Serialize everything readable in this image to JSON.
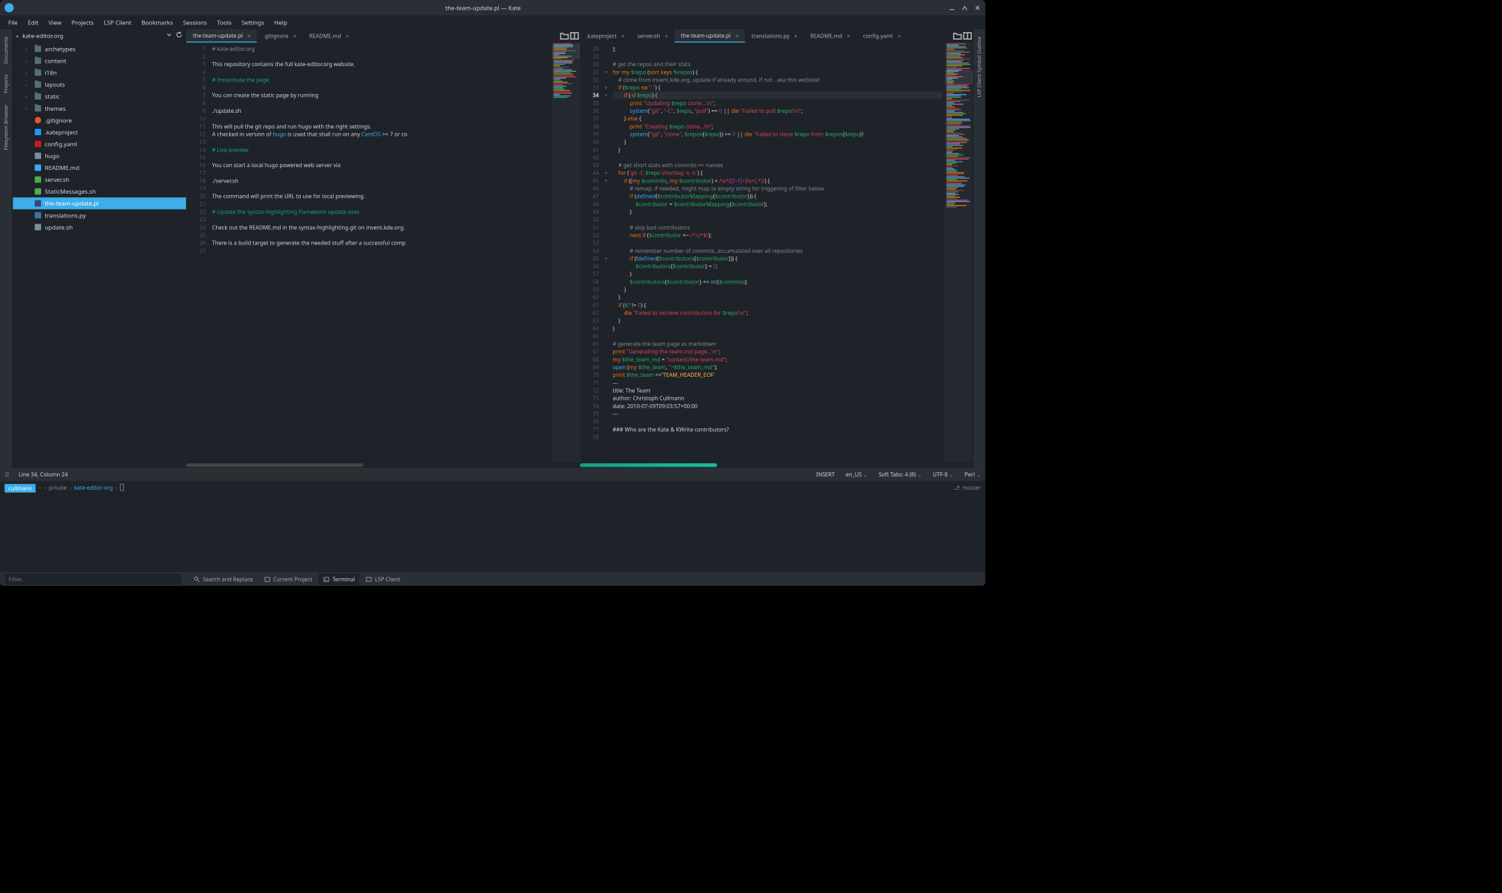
{
  "window": {
    "title": "the-team-update.pl — Kate"
  },
  "menu": [
    "File",
    "Edit",
    "View",
    "Projects",
    "LSP Client",
    "Bookmarks",
    "Sessions",
    "Tools",
    "Settings",
    "Help"
  ],
  "leftrail": [
    "Documents",
    "Projects",
    "Filesystem Browser"
  ],
  "rightrail": [
    "LSP Client Symbol Outline"
  ],
  "project": {
    "name": "kate-editor.org"
  },
  "tree": [
    {
      "label": "archetypes",
      "type": "folder",
      "expand": true
    },
    {
      "label": "content",
      "type": "folder",
      "expand": true
    },
    {
      "label": "i18n",
      "type": "folder",
      "expand": true
    },
    {
      "label": "layouts",
      "type": "folder",
      "expand": true
    },
    {
      "label": "static",
      "type": "folder",
      "expand": true
    },
    {
      "label": "themes",
      "type": "folder",
      "expand": true
    },
    {
      "label": ".gitignore",
      "type": "git"
    },
    {
      "label": ".kateproject",
      "type": "blue"
    },
    {
      "label": "config.yaml",
      "type": "yml"
    },
    {
      "label": "hugo",
      "type": "file"
    },
    {
      "label": "README.md",
      "type": "md"
    },
    {
      "label": "server.sh",
      "type": "sh"
    },
    {
      "label": "StaticMessages.sh",
      "type": "sh"
    },
    {
      "label": "the-team-update.pl",
      "type": "pl",
      "sel": true
    },
    {
      "label": "translations.py",
      "type": "py"
    },
    {
      "label": "update.sh",
      "type": "file"
    }
  ],
  "leftTabs": [
    {
      "label": "the-team-update.pl",
      "act": true
    },
    {
      "label": ".gitignore"
    },
    {
      "label": "README.md"
    }
  ],
  "rightTabs": [
    {
      "label": ".kateproject"
    },
    {
      "label": "server.sh"
    },
    {
      "label": "the-team-update.pl",
      "act": true
    },
    {
      "label": "translations.py"
    },
    {
      "label": "README.md"
    },
    {
      "label": "config.yaml"
    }
  ],
  "leftLines": [
    1,
    2,
    3,
    4,
    5,
    6,
    7,
    8,
    9,
    10,
    11,
    12,
    13,
    14,
    15,
    16,
    17,
    18,
    19,
    20,
    21,
    22,
    23,
    24,
    25,
    26,
    27
  ],
  "rightLines": [
    28,
    29,
    30,
    31,
    32,
    33,
    34,
    35,
    36,
    37,
    38,
    39,
    40,
    41,
    42,
    43,
    44,
    45,
    46,
    47,
    48,
    49,
    50,
    51,
    52,
    53,
    54,
    55,
    56,
    57,
    58,
    59,
    60,
    61,
    62,
    63,
    64,
    65,
    66,
    67,
    68,
    69,
    70,
    71,
    72,
    73,
    74,
    75,
    76,
    77,
    78
  ],
  "leftCode": [
    "<span class='c-c'># kate-editor.org</span>",
    "",
    "This repository contains the full kate-editor.org website.",
    "",
    "<span class='c-h'># Instantiate the page</span>",
    "",
    "You can create the static page by running",
    "",
    "./update.sh",
    "",
    "This will pull the git repo and run hugo with the right settings.",
    "A checked in version of <span class='c-f'>hugo</span> is used that shall run on any <span class='c-f'>CentOS</span> >= 7 or co",
    "",
    "<span class='c-h'># Live preview</span>",
    "",
    "You can start a local hugo powered web server via",
    "",
    "./server.sh",
    "",
    "The command will print the URL to use for local previewing.",
    "",
    "<span class='c-h'># Update the syntax-highlighting framework update sites</span>",
    "",
    "Check out the README.md in the syntax-highlighting.git on invent.kde.org.",
    "",
    "There is a build target to generate the needed stuff after a successful comp",
    ""
  ],
  "rightCode": [
    ");",
    "",
    "<span class='c-c'># get the repos and their stats</span>",
    "<span class='c-k'>for</span> <span class='c-k'>my</span> <span class='c-v'>$repo</span> (<span class='c-k'>sort</span> <span class='c-k'>keys</span> <span class='c-v'>%repos</span>) {",
    "    <span class='c-c'># clone from invent.kde.org, update if already around, if not . aka this website!</span>",
    "    <span class='c-k'>if</span> (<span class='c-v'>$repo</span> <span class='c-k'>ne</span> <span class='c-s'>\".\"</span>) {",
    "        <span class='c-k'>if</span> (<span class='c-k'>-d</span> <span class='c-v'>$repo</span>) <span class='c-b'>{</span>",
    "            <span class='c-k'>print</span> <span class='c-s'>\"Updating </span><span class='c-v'>$repo</span><span class='c-s'> clone...\\n\"</span>;",
    "            <span class='c-f'>system</span>(<span class='c-s'>\"git\"</span>, <span class='c-s'>\"-C\"</span>, <span class='c-v'>$repo</span>, <span class='c-s'>\"pull\"</span>) == <span class='c-n'>0</span> || <span class='c-k'>die</span> <span class='c-s'>\"Failed to pull </span><span class='c-v'>$repo</span><span class='c-s'>!\\n\"</span>;",
    "        <span class='c-b'>}</span> <span class='c-k'>else</span> {",
    "            <span class='c-k'>print</span> <span class='c-s'>\"Creating </span><span class='c-v'>$repo</span><span class='c-s'> clone...\\n\"</span>;",
    "            <span class='c-f'>system</span>(<span class='c-s'>\"git\"</span>, <span class='c-s'>\"clone\"</span>, <span class='c-v'>$repos</span>{<span class='c-v'>$repo</span>}) == <span class='c-n'>0</span> || <span class='c-k'>die</span> <span class='c-s'>\"Failed to clone </span><span class='c-v'>$repo</span><span class='c-s'> from </span><span class='c-v'>$repos</span>{<span class='c-v'>$repo</span>}!",
    "        }",
    "    }",
    "",
    "    <span class='c-c'># get short stats with commits =&gt; names</span>",
    "    <span class='c-k'>for</span> (<span class='c-s'>`git -C </span><span class='c-v'>$repo</span><span class='c-s'> shortlog -s -n`</span>) {",
    "        <span class='c-k'>if</span> ((<span class='c-k'>my</span> <span class='c-v'>$commits</span>, <span class='c-k'>my</span> <span class='c-v'>$contributor</span>) = <span class='c-s'>/\\s*(</span><span class='c-n'>[0-9]+</span><span class='c-s'>)\\s+(.*)/</span>) {",
    "            <span class='c-c'># remap, if needed, might map to empty string for triggering of filter below</span>",
    "            <span class='c-k'>if</span> (<span class='c-f'>defined</span>(<span class='c-v'>$contributorMapping</span>{<span class='c-v'>$contributor</span>})) {",
    "                <span class='c-v'>$contributor</span> = <span class='c-v'>$contributorMapping</span>{<span class='c-v'>$contributor</span>};",
    "            }",
    "",
    "            <span class='c-c'># skip bad contributors</span>",
    "            <span class='c-k'>next</span> <span class='c-k'>if</span> (<span class='c-v'>$contributor</span> =~ <span class='c-s'>/^\\s*$/</span>);",
    "",
    "            <span class='c-c'># remember number of commits, accumulated over all repositories</span>",
    "            <span class='c-k'>if</span> (!<span class='c-f'>defined</span>(<span class='c-v'>$contributors</span>{<span class='c-v'>$contributor</span>})) {",
    "                <span class='c-v'>$contributors</span>{<span class='c-v'>$contributor</span>} = <span class='c-n'>0</span>;",
    "            }",
    "            <span class='c-v'>$contributors</span>{<span class='c-v'>$contributor</span>} += <span class='c-f'>int</span>(<span class='c-v'>$commits</span>);",
    "        }",
    "    }",
    "    <span class='c-k'>if</span> (<span class='c-v'>$?</span> != <span class='c-n'>0</span>) {",
    "        <span class='c-k'>die</span> <span class='c-s'>\"Failed to retrieve contributors for </span><span class='c-v'>$repo</span><span class='c-s'>!\\n\"</span>;",
    "    }",
    "}",
    "",
    "<span class='c-c'># generate the team page as markdown</span>",
    "<span class='c-k'>print</span> <span class='c-s'>\"Generating the-team.md page...\\n\"</span>;",
    "<span class='c-k'>my</span> <span class='c-v'>$the_team_md</span> = <span class='c-s'>\"content/the-team.md\"</span>;",
    "<span class='c-f'>open</span> (<span class='c-k'>my</span> <span class='c-v'>$the_team</span>, <span class='c-s'>\"&gt;</span><span class='c-v'>$the_team_md</span><span class='c-s'>\"</span>);",
    "<span class='c-k'>print</span> <span class='c-v'>$the_team</span> &lt;&lt;<span class='c-b'>'TEAM_HEADER_EOF'</span>",
    "---",
    "title: The Team",
    "author: Christoph Cullmann",
    "date: 2010-07-09T09:03:57+00:00",
    "---",
    "",
    "### Who are the Kate &amp; KWrite contributors?",
    "",
    ""
  ],
  "status": {
    "pos": "Line 34, Column 24",
    "mode": "INSERT",
    "lang": "en_US",
    "indent": "Soft Tabs: 4 (8)",
    "enc": "UTF-8",
    "syntax": "Perl"
  },
  "term": {
    "user": "cullmann",
    "path": "private",
    "dir": "kate-editor-org",
    "branch": "master"
  },
  "filter": {
    "placeholder": "Filter..."
  },
  "btabs": [
    {
      "label": "Search and Replace"
    },
    {
      "label": "Current Project"
    },
    {
      "label": "Terminal",
      "act": true
    },
    {
      "label": "LSP Client"
    }
  ]
}
